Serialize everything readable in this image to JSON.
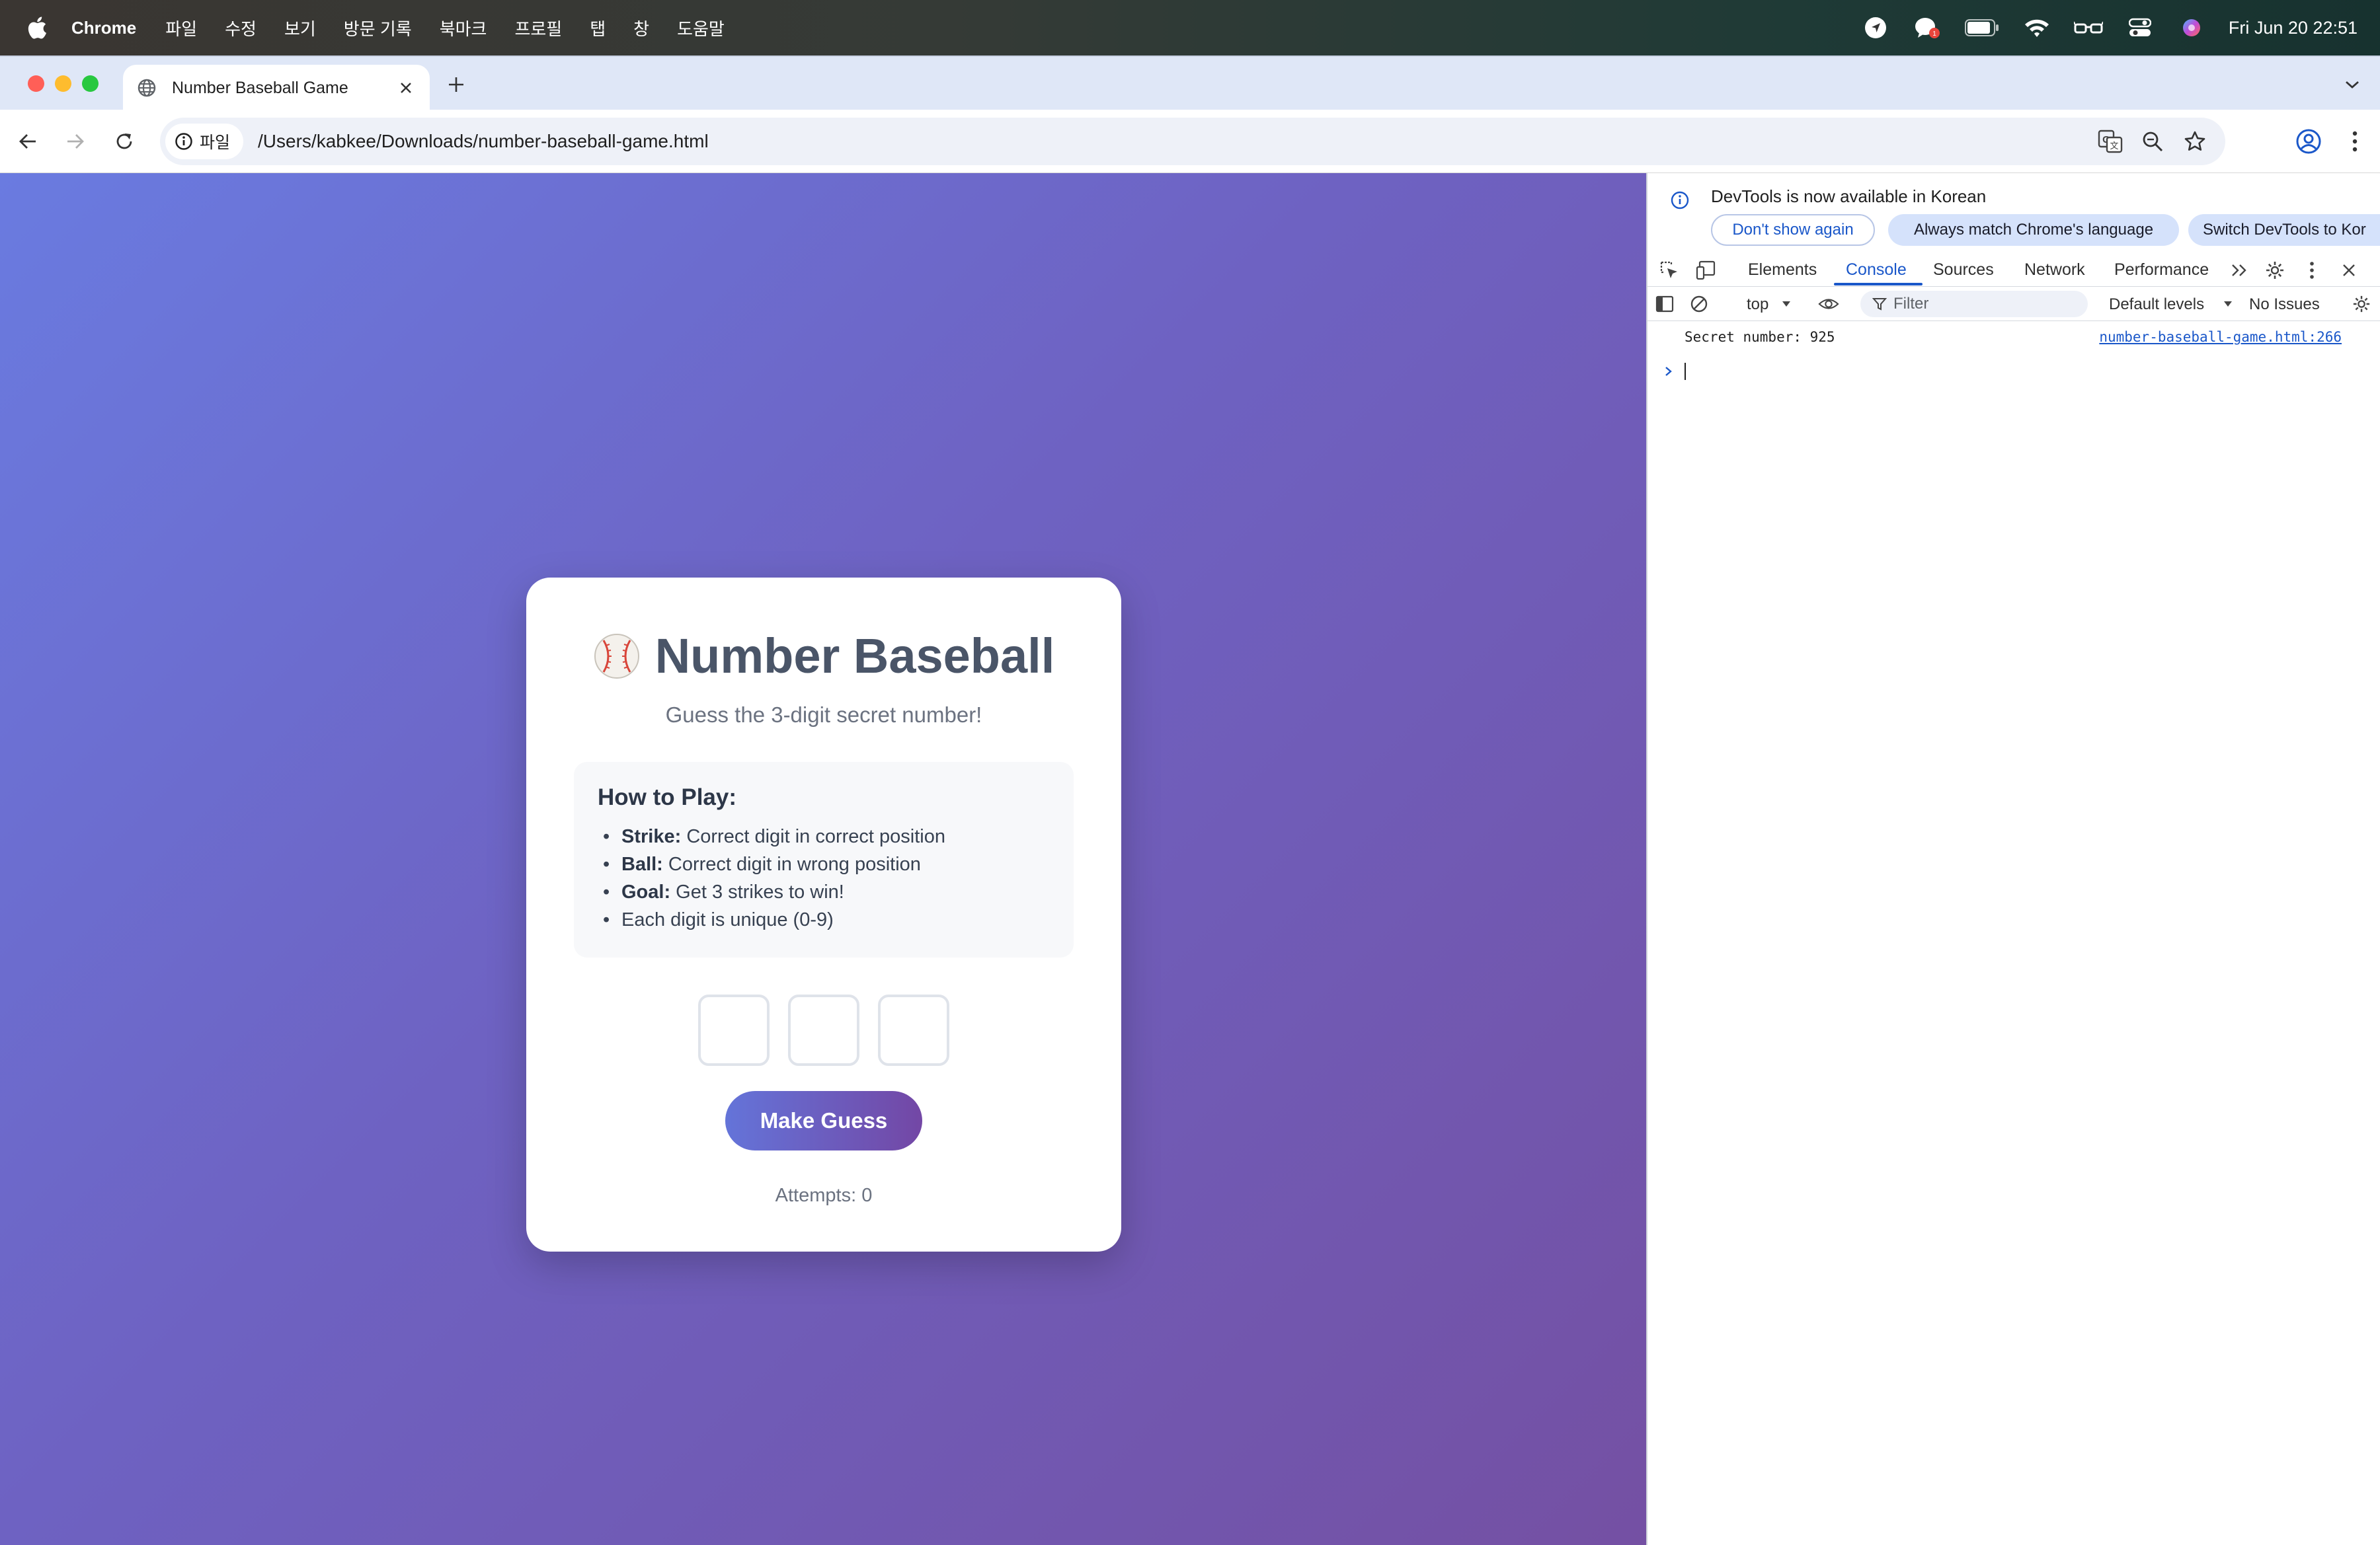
{
  "menubar": {
    "app_name": "Chrome",
    "items": [
      "파일",
      "수정",
      "보기",
      "방문 기록",
      "북마크",
      "프로필",
      "탭",
      "창",
      "도움말"
    ],
    "clock": "Fri Jun 20  22:51",
    "status_icons": [
      "location-icon",
      "messenger-icon",
      "battery-icon",
      "wifi-icon",
      "glasses-icon",
      "control-center-icon",
      "siri-icon"
    ]
  },
  "browser": {
    "tab_title": "Number Baseball Game",
    "site_chip": "파일",
    "url": "/Users/kabkee/Downloads/number-baseball-game.html"
  },
  "game": {
    "title": "Number Baseball",
    "subtitle": "Guess the 3-digit secret number!",
    "rules_heading": "How to Play:",
    "rules": [
      {
        "term": "Strike:",
        "text": " Correct digit in correct position"
      },
      {
        "term": "Ball:",
        "text": " Correct digit in wrong position"
      },
      {
        "term": "Goal:",
        "text": " Get 3 strikes to win!"
      },
      {
        "term": "",
        "text": "Each digit is unique (0-9)"
      }
    ],
    "digit_values": [
      "",
      "",
      ""
    ],
    "guess_button": "Make Guess",
    "attempts": "Attempts: 0"
  },
  "devtools": {
    "banner_message": "DevTools is now available in Korean",
    "btn_dont_show": "Don't show again",
    "btn_always_match": "Always match Chrome's language",
    "btn_switch": "Switch DevTools to Kor",
    "tabs": [
      "Elements",
      "Console",
      "Sources",
      "Network",
      "Performance"
    ],
    "active_tab": "Console",
    "context": "top",
    "filter_placeholder": "Filter",
    "levels": "Default levels",
    "issues": "No Issues",
    "console_log": "Secret number: 925",
    "console_source": "number-baseball-game.html:266"
  },
  "colors": {
    "accent_blue": "#1a57c9",
    "gradient_start": "#6a7be0",
    "gradient_end": "#7450a3",
    "title_text": "#4a5568"
  }
}
